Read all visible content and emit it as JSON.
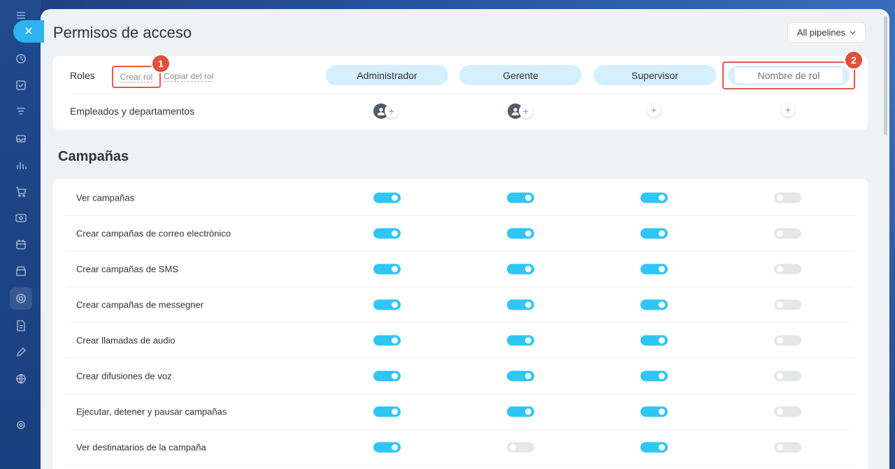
{
  "header": {
    "title": "Permisos de acceso",
    "pipeline_select": "All pipelines"
  },
  "roles": {
    "label": "Roles",
    "create_role": "Crear rol",
    "copy_role": "Copiar del rol",
    "columns": [
      "Administrador",
      "Gerente",
      "Supervisor"
    ],
    "new_role_placeholder": "Nombre de rol"
  },
  "employees": {
    "label": "Empleados y departamentos"
  },
  "badges": [
    "1",
    "2"
  ],
  "section": {
    "title": "Campañas"
  },
  "permissions": [
    {
      "label": "Ver campañas",
      "states": [
        true,
        true,
        true,
        false
      ]
    },
    {
      "label": "Crear campañas de correo electrónico",
      "states": [
        true,
        true,
        true,
        false
      ]
    },
    {
      "label": "Crear campañas de SMS",
      "states": [
        true,
        true,
        true,
        false
      ]
    },
    {
      "label": "Crear campañas de messegner",
      "states": [
        true,
        true,
        true,
        false
      ]
    },
    {
      "label": "Crear llamadas de audio",
      "states": [
        true,
        true,
        true,
        false
      ]
    },
    {
      "label": "Crear difusiones de voz",
      "states": [
        true,
        true,
        true,
        false
      ]
    },
    {
      "label": "Ejecutar, detener y pausar campañas",
      "states": [
        true,
        true,
        true,
        false
      ]
    },
    {
      "label": "Ver destinatarios de la campaña",
      "states": [
        true,
        false,
        true,
        false
      ]
    }
  ],
  "colors": {
    "accent": "#2fc6f6",
    "pill": "#d5efff",
    "highlight": "#e05a4b"
  }
}
